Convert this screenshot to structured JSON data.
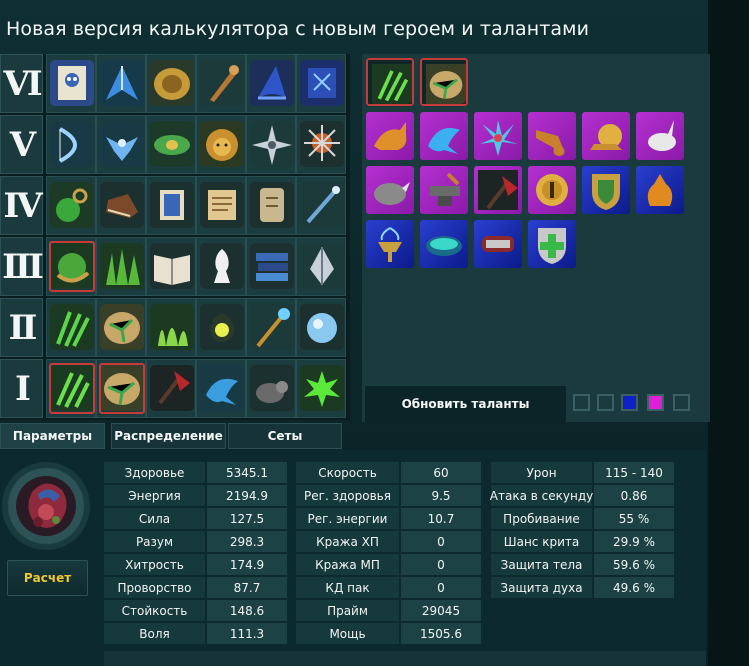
{
  "title": "Новая версия калькулятора с новым героем и талантами",
  "tree": {
    "rows": [
      {
        "label": "VI",
        "icons": [
          "owl-scroll-icon",
          "blue-blades-icon",
          "gold-shield-icon",
          "wooden-club-icon",
          "wizard-hat-icon",
          "rune-tome-icon"
        ]
      },
      {
        "label": "V",
        "icons": [
          "bow-icon",
          "blue-bird-icon",
          "green-belt-icon",
          "lion-icon",
          "shuriken-icon",
          "spiked-mace-icon"
        ]
      },
      {
        "label": "IV",
        "icons": [
          "green-chain-icon",
          "leather-boot-icon",
          "blue-scroll-icon",
          "parchment-icon",
          "stone-tablet-icon",
          "magic-wand-icon"
        ]
      },
      {
        "label": "III",
        "icons": [
          "chain-fist-icon",
          "grass-spikes-icon",
          "open-book-icon",
          "chess-bishop-icon",
          "book-stack-icon",
          "arrowhead-icon"
        ]
      },
      {
        "label": "II",
        "icons": [
          "green-claws-icon",
          "cracked-stone-icon",
          "grass-tuft-icon",
          "kettlebell-icon",
          "crystal-staff-icon",
          "crystal-orb-icon"
        ]
      },
      {
        "label": "I",
        "icons": [
          "claw-strike-icon",
          "stone-crack-icon",
          "red-axe-icon",
          "blue-dolphin-icon",
          "rat-icon",
          "green-splash-icon"
        ]
      }
    ]
  },
  "talents": {
    "top": [
      "claw-strike-icon",
      "stone-crack-icon"
    ],
    "row1": [
      {
        "icon": "fox-icon",
        "bg": "purple"
      },
      {
        "icon": "dolphin-icon",
        "bg": "purple"
      },
      {
        "icon": "pinwheel-icon",
        "bg": "purple"
      },
      {
        "icon": "pipe-icon",
        "bg": "purple"
      },
      {
        "icon": "gold-snail-icon",
        "bg": "purple"
      },
      {
        "icon": "white-rabbit-icon",
        "bg": "purple"
      }
    ],
    "row2": [
      {
        "icon": "rhino-icon",
        "bg": "purple"
      },
      {
        "icon": "anvil-icon",
        "bg": "purple"
      },
      {
        "icon": "red-axe-icon",
        "bg": "purple"
      },
      {
        "icon": "gold-medal-icon",
        "bg": "purple"
      },
      {
        "icon": "heraldic-shield-icon",
        "bg": "blue"
      },
      {
        "icon": "gold-pouch-icon",
        "bg": "blue"
      }
    ],
    "row3": [
      {
        "icon": "fountain-icon",
        "bg": "blue"
      },
      {
        "icon": "green-band-icon",
        "bg": "blue"
      },
      {
        "icon": "red-gauntlet-icon",
        "bg": "blue"
      },
      {
        "icon": "cross-shield-icon",
        "bg": "blue"
      }
    ],
    "update_label": "Обновить таланты",
    "swatches": [
      "#1b3a3d",
      "#1b3a3d",
      "#1020c8",
      "#e020d8",
      "#1b3a3d"
    ]
  },
  "tabs": [
    "Параметры",
    "Распределение",
    "Сеты"
  ],
  "calc_label": "Расчет",
  "stats": {
    "col1": [
      {
        "label": "Здоровье",
        "value": "5345.1"
      },
      {
        "label": "Энергия",
        "value": "2194.9"
      },
      {
        "label": "Сила",
        "value": "127.5"
      },
      {
        "label": "Разум",
        "value": "298.3"
      },
      {
        "label": "Хитрость",
        "value": "174.9"
      },
      {
        "label": "Проворство",
        "value": "87.7"
      },
      {
        "label": "Стойкость",
        "value": "148.6"
      },
      {
        "label": "Воля",
        "value": "111.3"
      }
    ],
    "col2": [
      {
        "label": "Скорость",
        "value": "60"
      },
      {
        "label": "Рег. здоровья",
        "value": "9.5"
      },
      {
        "label": "Рег. энергии",
        "value": "10.7"
      },
      {
        "label": "Кража ХП",
        "value": "0"
      },
      {
        "label": "Кража МП",
        "value": "0"
      },
      {
        "label": "КД пак",
        "value": "0"
      },
      {
        "label": "Прайм",
        "value": "29045"
      },
      {
        "label": "Мощь",
        "value": "1505.6"
      }
    ],
    "col3": [
      {
        "label": "Урон",
        "value": "115 - 140"
      },
      {
        "label": "Атака в секунду",
        "value": "0.86"
      },
      {
        "label": "Пробивание",
        "value": "55 %"
      },
      {
        "label": "Шанс крита",
        "value": "29.9 %"
      },
      {
        "label": "Защита тела",
        "value": "59.6 %"
      },
      {
        "label": "Защита духа",
        "value": "49.6 %"
      }
    ]
  }
}
